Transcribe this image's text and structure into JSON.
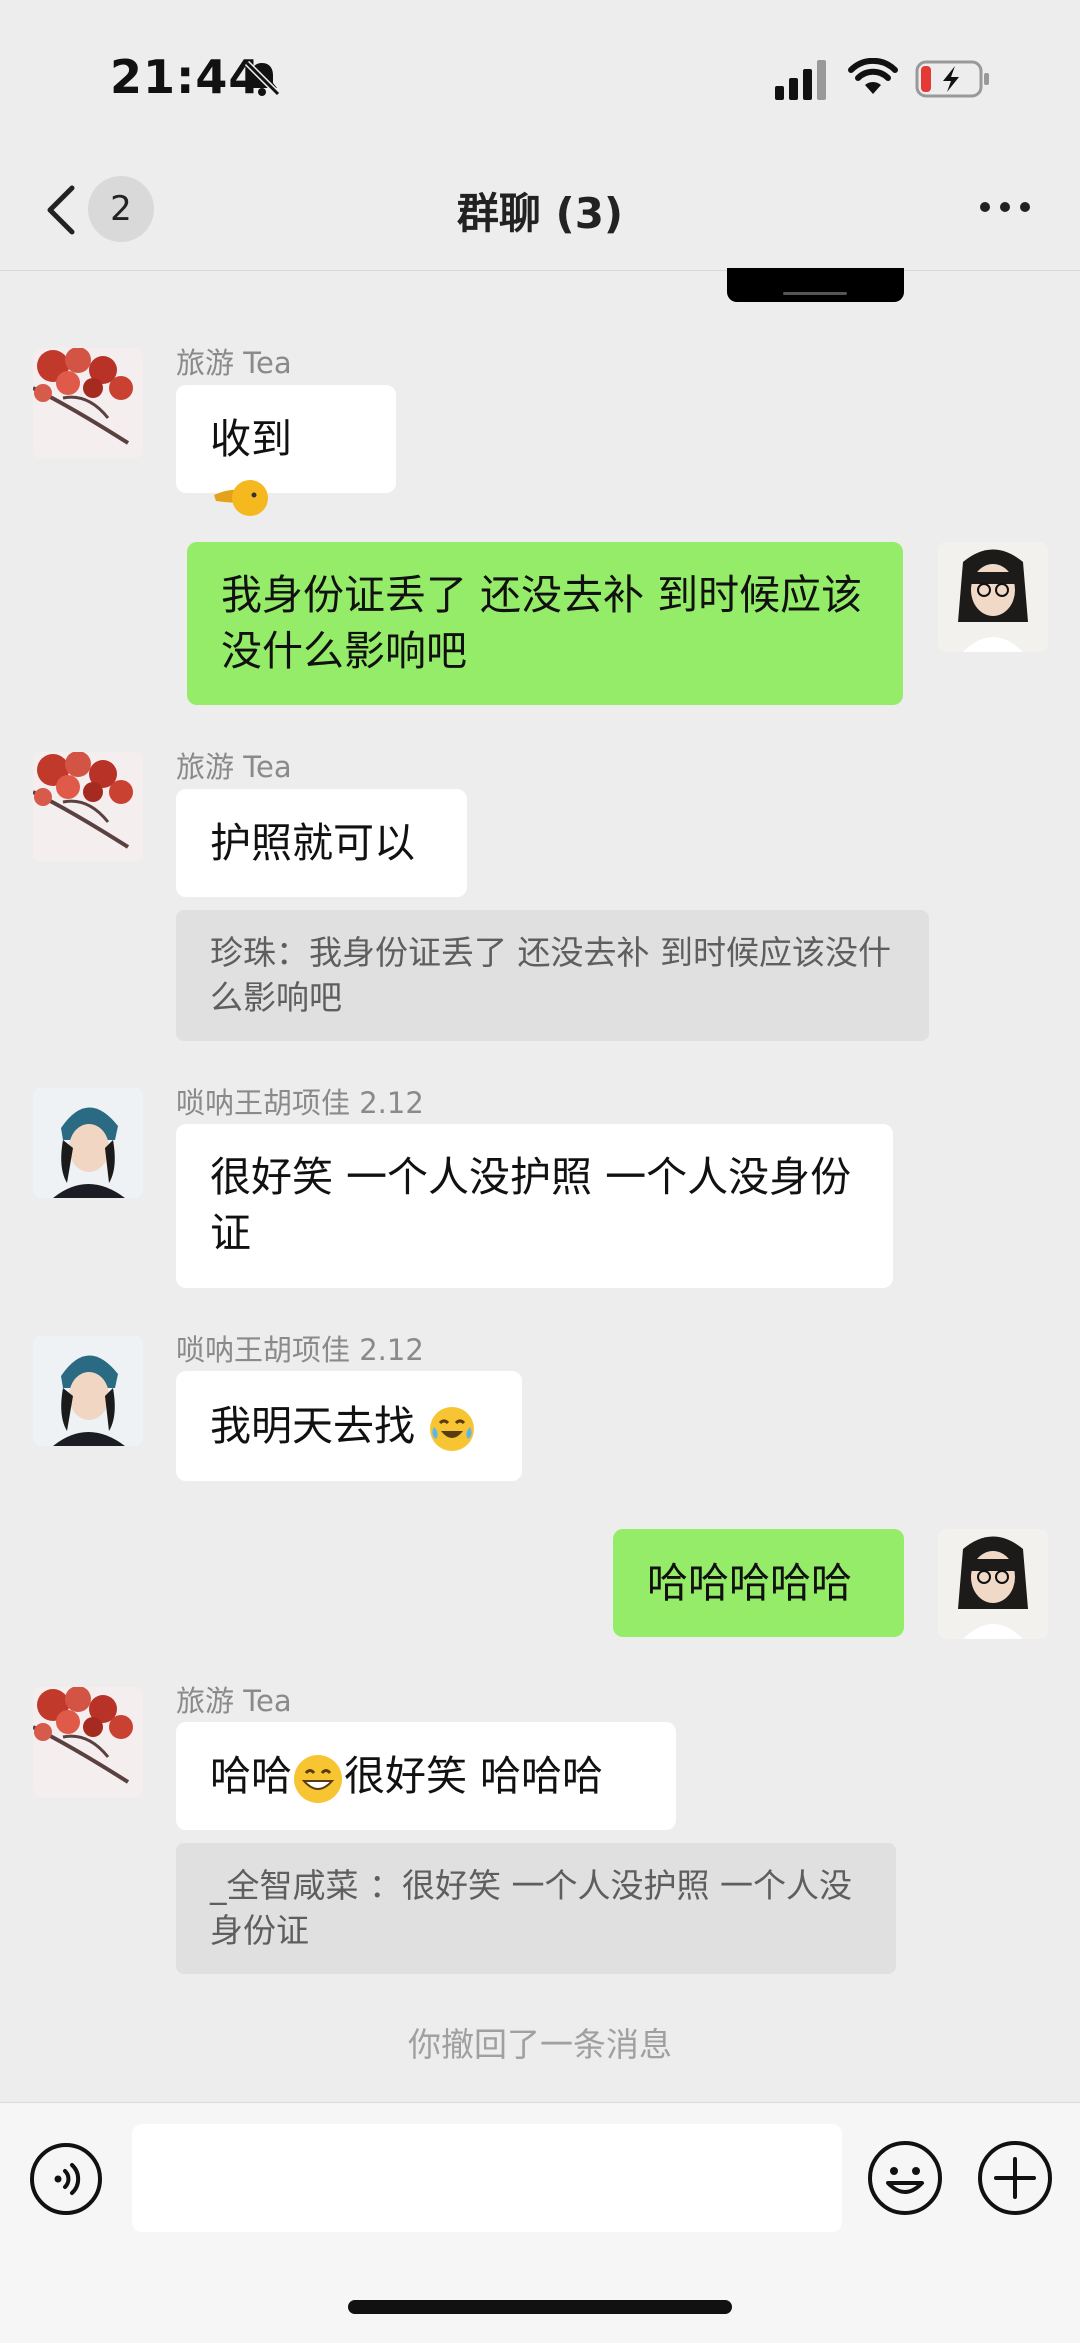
{
  "status_bar": {
    "time": "21:44"
  },
  "nav": {
    "unread_count": "2",
    "title": "群聊 (3)"
  },
  "messages": [
    {
      "sender": "旅游 Tea",
      "text": "收到"
    },
    {
      "text": "我身份证丢了 还没去补 到时候应该没什么影响吧"
    },
    {
      "sender": "旅游 Tea",
      "text": "护照就可以",
      "quote": "珍珠：我身份证丢了 还没去补 到时候应该没什么影响吧"
    },
    {
      "sender": "唢呐王胡项佳 2.12",
      "text": "很好笑 一个人没护照 一个人没身份证"
    },
    {
      "sender": "唢呐王胡项佳 2.12",
      "text": "我明天去找"
    },
    {
      "text": "哈哈哈哈哈"
    },
    {
      "sender": "旅游 Tea",
      "text_before": "哈哈",
      "text_after": "很好笑 哈哈哈",
      "quote": "_全智咸菜 ：很好笑 一个人没护照 一个人没身份证"
    }
  ],
  "system": {
    "recall_notice": "你撤回了一条消息"
  },
  "icons": [
    "back-icon",
    "more-icon",
    "voice-icon",
    "emoji-icon",
    "plus-icon",
    "bell-slash-icon",
    "signal-icon",
    "wifi-icon",
    "battery-icon"
  ],
  "colors": {
    "background": "#ededed",
    "outgoing_bubble": "#95ec69",
    "incoming_bubble": "#ffffff",
    "quote_bg": "#e0e0e0"
  }
}
